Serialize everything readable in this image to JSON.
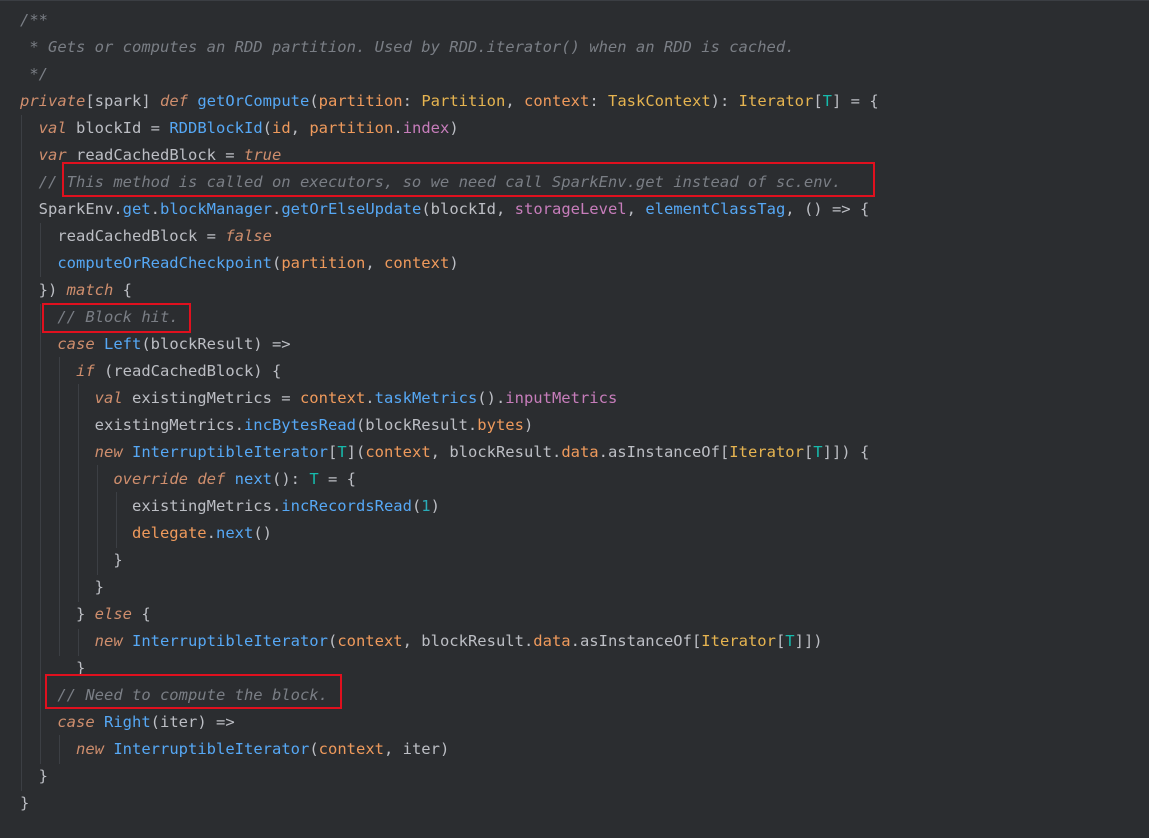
{
  "editor": {
    "language": "Scala",
    "colors": {
      "background": "#2b2d30",
      "keyword": "#cf8e6d",
      "comment": "#7a7e85",
      "function": "#56a8f5",
      "type": "#e6b450",
      "parameter": "#ef9a5c",
      "type_param": "#16baac",
      "field": "#c77dbb",
      "number": "#2aacb8",
      "plain": "#bcbec4",
      "highlight_box": "#e0101e"
    },
    "lines": [
      [
        {
          "t": "/**",
          "c": "cmt"
        }
      ],
      [
        {
          "t": " * Gets or computes an RDD partition. Used by RDD.iterator() when an RDD is cached.",
          "c": "cmt"
        }
      ],
      [
        {
          "t": " */",
          "c": "cmt"
        }
      ],
      [
        {
          "t": "private",
          "c": "kwi"
        },
        {
          "t": "[spark] ",
          "c": "pl"
        },
        {
          "t": "def",
          "c": "kwi"
        },
        {
          "t": " ",
          "c": "pl"
        },
        {
          "t": "getOrCompute",
          "c": "fn"
        },
        {
          "t": "(",
          "c": "pl"
        },
        {
          "t": "partition",
          "c": "param"
        },
        {
          "t": ": ",
          "c": "pl"
        },
        {
          "t": "Partition",
          "c": "ty"
        },
        {
          "t": ", ",
          "c": "pl"
        },
        {
          "t": "context",
          "c": "param"
        },
        {
          "t": ": ",
          "c": "pl"
        },
        {
          "t": "TaskContext",
          "c": "ty"
        },
        {
          "t": "): ",
          "c": "pl"
        },
        {
          "t": "Iterator",
          "c": "ty"
        },
        {
          "t": "[",
          "c": "pl"
        },
        {
          "t": "T",
          "c": "tp"
        },
        {
          "t": "] = {",
          "c": "pl"
        }
      ],
      [
        {
          "t": "  ",
          "c": "pl"
        },
        {
          "t": "val",
          "c": "kwi"
        },
        {
          "t": " blockId = ",
          "c": "pl"
        },
        {
          "t": "RDDBlockId",
          "c": "fn"
        },
        {
          "t": "(",
          "c": "pl"
        },
        {
          "t": "id",
          "c": "param"
        },
        {
          "t": ", ",
          "c": "pl"
        },
        {
          "t": "partition",
          "c": "param"
        },
        {
          "t": ".",
          "c": "pl"
        },
        {
          "t": "index",
          "c": "fld"
        },
        {
          "t": ")",
          "c": "pl"
        }
      ],
      [
        {
          "t": "  ",
          "c": "pl"
        },
        {
          "t": "var",
          "c": "kwi"
        },
        {
          "t": " readCachedBlock = ",
          "c": "pl"
        },
        {
          "t": "true",
          "c": "kwi"
        }
      ],
      [
        {
          "t": "  // This method is called on executors, so we need call SparkEnv.get instead of sc.env.",
          "c": "cmt"
        }
      ],
      [
        {
          "t": "  SparkEnv",
          "c": "pl"
        },
        {
          "t": ".",
          "c": "pl"
        },
        {
          "t": "get",
          "c": "fn"
        },
        {
          "t": ".",
          "c": "pl"
        },
        {
          "t": "blockManager",
          "c": "fn"
        },
        {
          "t": ".",
          "c": "pl"
        },
        {
          "t": "getOrElseUpdate",
          "c": "fn"
        },
        {
          "t": "(blockId, ",
          "c": "pl"
        },
        {
          "t": "storageLevel",
          "c": "fld"
        },
        {
          "t": ", ",
          "c": "pl"
        },
        {
          "t": "elementClassTag",
          "c": "fn"
        },
        {
          "t": ", () => {",
          "c": "pl"
        }
      ],
      [
        {
          "t": "    readCachedBlock = ",
          "c": "pl"
        },
        {
          "t": "false",
          "c": "kwi"
        }
      ],
      [
        {
          "t": "    ",
          "c": "pl"
        },
        {
          "t": "computeOrReadCheckpoint",
          "c": "fn"
        },
        {
          "t": "(",
          "c": "pl"
        },
        {
          "t": "partition",
          "c": "param"
        },
        {
          "t": ", ",
          "c": "pl"
        },
        {
          "t": "context",
          "c": "param"
        },
        {
          "t": ")",
          "c": "pl"
        }
      ],
      [
        {
          "t": "  }) ",
          "c": "pl"
        },
        {
          "t": "match",
          "c": "kwi"
        },
        {
          "t": " {",
          "c": "pl"
        }
      ],
      [
        {
          "t": "    // Block hit.",
          "c": "cmt"
        }
      ],
      [
        {
          "t": "    ",
          "c": "pl"
        },
        {
          "t": "case",
          "c": "kwi"
        },
        {
          "t": " ",
          "c": "pl"
        },
        {
          "t": "Left",
          "c": "fn"
        },
        {
          "t": "(blockResult) =>",
          "c": "pl"
        }
      ],
      [
        {
          "t": "      ",
          "c": "pl"
        },
        {
          "t": "if",
          "c": "kwi"
        },
        {
          "t": " (readCachedBlock) {",
          "c": "pl"
        }
      ],
      [
        {
          "t": "        ",
          "c": "pl"
        },
        {
          "t": "val",
          "c": "kwi"
        },
        {
          "t": " existingMetrics = ",
          "c": "pl"
        },
        {
          "t": "context",
          "c": "param"
        },
        {
          "t": ".",
          "c": "pl"
        },
        {
          "t": "taskMetrics",
          "c": "fn"
        },
        {
          "t": "().",
          "c": "pl"
        },
        {
          "t": "inputMetrics",
          "c": "fld"
        }
      ],
      [
        {
          "t": "        existingMetrics.",
          "c": "pl"
        },
        {
          "t": "incBytesRead",
          "c": "fn"
        },
        {
          "t": "(blockResult.",
          "c": "pl"
        },
        {
          "t": "bytes",
          "c": "param"
        },
        {
          "t": ")",
          "c": "pl"
        }
      ],
      [
        {
          "t": "        ",
          "c": "pl"
        },
        {
          "t": "new",
          "c": "kwi"
        },
        {
          "t": " ",
          "c": "pl"
        },
        {
          "t": "InterruptibleIterator",
          "c": "fn"
        },
        {
          "t": "[",
          "c": "pl"
        },
        {
          "t": "T",
          "c": "tp"
        },
        {
          "t": "](",
          "c": "pl"
        },
        {
          "t": "context",
          "c": "param"
        },
        {
          "t": ", blockResult.",
          "c": "pl"
        },
        {
          "t": "data",
          "c": "param"
        },
        {
          "t": ".asInstanceOf[",
          "c": "pl"
        },
        {
          "t": "Iterator",
          "c": "ty"
        },
        {
          "t": "[",
          "c": "pl"
        },
        {
          "t": "T",
          "c": "tp"
        },
        {
          "t": "]]) {",
          "c": "pl"
        }
      ],
      [
        {
          "t": "          ",
          "c": "pl"
        },
        {
          "t": "override",
          "c": "kwi"
        },
        {
          "t": " ",
          "c": "pl"
        },
        {
          "t": "def",
          "c": "kwi"
        },
        {
          "t": " ",
          "c": "pl"
        },
        {
          "t": "next",
          "c": "fn"
        },
        {
          "t": "(): ",
          "c": "pl"
        },
        {
          "t": "T",
          "c": "tp"
        },
        {
          "t": " = {",
          "c": "pl"
        }
      ],
      [
        {
          "t": "            existingMetrics.",
          "c": "pl"
        },
        {
          "t": "incRecordsRead",
          "c": "fn"
        },
        {
          "t": "(",
          "c": "pl"
        },
        {
          "t": "1",
          "c": "num"
        },
        {
          "t": ")",
          "c": "pl"
        }
      ],
      [
        {
          "t": "            ",
          "c": "pl"
        },
        {
          "t": "delegate",
          "c": "param"
        },
        {
          "t": ".",
          "c": "pl"
        },
        {
          "t": "next",
          "c": "fn"
        },
        {
          "t": "()",
          "c": "pl"
        }
      ],
      [
        {
          "t": "          }",
          "c": "pl"
        }
      ],
      [
        {
          "t": "        }",
          "c": "pl"
        }
      ],
      [
        {
          "t": "      } ",
          "c": "pl"
        },
        {
          "t": "else",
          "c": "kwi"
        },
        {
          "t": " {",
          "c": "pl"
        }
      ],
      [
        {
          "t": "        ",
          "c": "pl"
        },
        {
          "t": "new",
          "c": "kwi"
        },
        {
          "t": " ",
          "c": "pl"
        },
        {
          "t": "InterruptibleIterator",
          "c": "fn"
        },
        {
          "t": "(",
          "c": "pl"
        },
        {
          "t": "context",
          "c": "param"
        },
        {
          "t": ", blockResult.",
          "c": "pl"
        },
        {
          "t": "data",
          "c": "param"
        },
        {
          "t": ".asInstanceOf[",
          "c": "pl"
        },
        {
          "t": "Iterator",
          "c": "ty"
        },
        {
          "t": "[",
          "c": "pl"
        },
        {
          "t": "T",
          "c": "tp"
        },
        {
          "t": "]])",
          "c": "pl"
        }
      ],
      [
        {
          "t": "      }",
          "c": "pl"
        }
      ],
      [
        {
          "t": "    // Need to compute the block.",
          "c": "cmt"
        }
      ],
      [
        {
          "t": "    ",
          "c": "pl"
        },
        {
          "t": "case",
          "c": "kwi"
        },
        {
          "t": " ",
          "c": "pl"
        },
        {
          "t": "Right",
          "c": "fn"
        },
        {
          "t": "(iter) =>",
          "c": "pl"
        }
      ],
      [
        {
          "t": "      ",
          "c": "pl"
        },
        {
          "t": "new",
          "c": "kwi"
        },
        {
          "t": " ",
          "c": "pl"
        },
        {
          "t": "InterruptibleIterator",
          "c": "fn"
        },
        {
          "t": "(",
          "c": "pl"
        },
        {
          "t": "context",
          "c": "param"
        },
        {
          "t": ", iter)",
          "c": "pl"
        }
      ],
      [
        {
          "t": "  }",
          "c": "pl"
        }
      ],
      [
        {
          "t": "}",
          "c": "pl"
        }
      ]
    ]
  }
}
